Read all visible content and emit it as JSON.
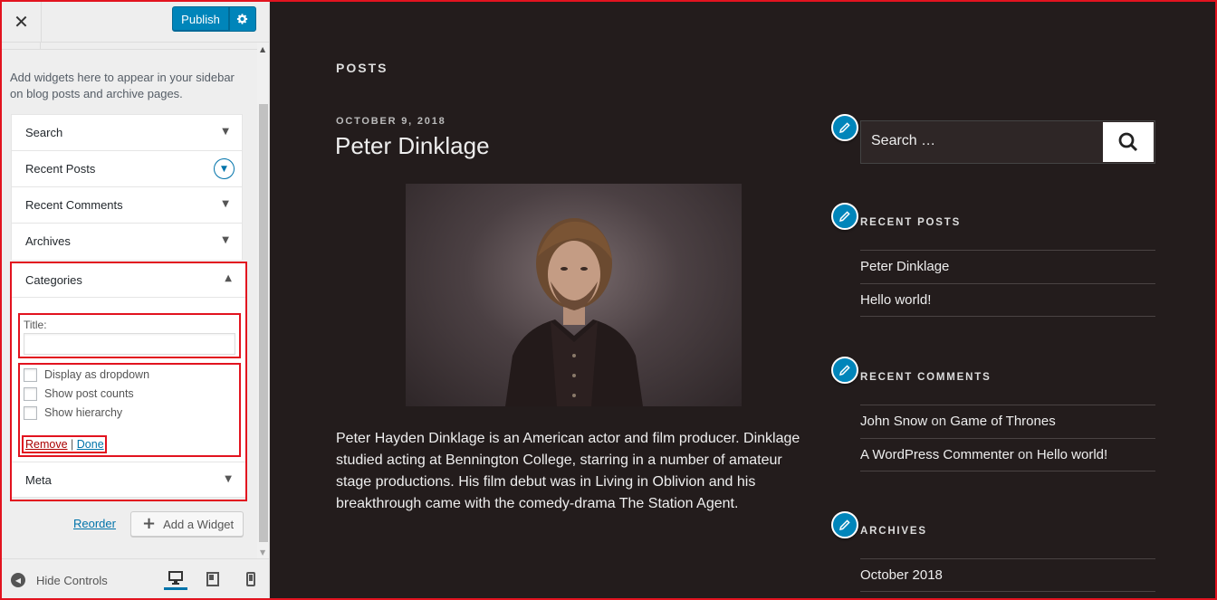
{
  "customizer": {
    "close_label": "✕",
    "publish_label": "Publish",
    "description": "Add widgets here to appear in your sidebar on blog posts and archive pages.",
    "widgets": [
      {
        "label": "Search"
      },
      {
        "label": "Recent Posts"
      },
      {
        "label": "Recent Comments"
      },
      {
        "label": "Archives"
      }
    ],
    "categories": {
      "label": "Categories",
      "title_label": "Title:",
      "title_value": "",
      "options": [
        {
          "label": "Display as dropdown",
          "checked": false
        },
        {
          "label": "Show post counts",
          "checked": false
        },
        {
          "label": "Show hierarchy",
          "checked": false
        }
      ],
      "remove_label": "Remove",
      "separator": "|",
      "done_label": "Done"
    },
    "meta_label": "Meta",
    "reorder_label": "Reorder",
    "add_widget_label": "Add a Widget",
    "hide_controls_label": "Hide Controls",
    "devices": [
      "desktop-icon",
      "tablet-icon",
      "mobile-icon"
    ],
    "accent_color": "#0085ba",
    "highlight_color": "#e2131f"
  },
  "preview": {
    "posts_heading": "POSTS",
    "post": {
      "date": "OCTOBER 9, 2018",
      "title": "Peter Dinklage",
      "body": "Peter Hayden Dinklage is an American actor and film producer. Dinklage studied acting at Bennington College, starring in a number of amateur stage productions. His film debut was in Living in Oblivion and his breakthrough came with the comedy-drama The Station Agent."
    },
    "search_placeholder": "Search …",
    "recent_posts": {
      "title": "RECENT POSTS",
      "items": [
        "Peter Dinklage",
        "Hello world!"
      ]
    },
    "recent_comments": {
      "title": "RECENT COMMENTS",
      "items": [
        {
          "author": "John Snow",
          "on": "on",
          "post": "Game of Thrones"
        },
        {
          "author": "A WordPress Commenter",
          "on": "on",
          "post": "Hello world!"
        }
      ]
    },
    "archives": {
      "title": "ARCHIVES",
      "items": [
        "October 2018"
      ]
    },
    "background_color": "#231c1c"
  }
}
